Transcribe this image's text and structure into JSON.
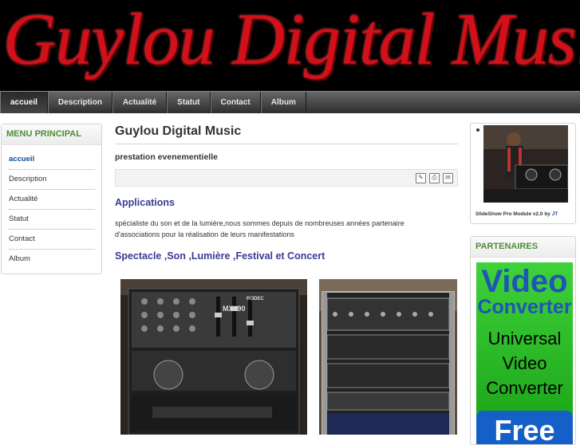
{
  "site": {
    "banner_title": "Guylou Digital Music"
  },
  "nav": {
    "items": [
      {
        "label": "accueil"
      },
      {
        "label": "Description"
      },
      {
        "label": "Actualité"
      },
      {
        "label": "Statut"
      },
      {
        "label": "Contact"
      },
      {
        "label": "Album"
      }
    ],
    "active": "accueil"
  },
  "sidebar": {
    "title": "MENU PRINCIPAL",
    "items": [
      {
        "label": "accueil"
      },
      {
        "label": "Description"
      },
      {
        "label": "Actualité"
      },
      {
        "label": "Statut"
      },
      {
        "label": "Contact"
      },
      {
        "label": "Album"
      }
    ]
  },
  "main": {
    "title": "Guylou Digital Music",
    "subtitle": "prestation evenementielle",
    "toolbar_icons": [
      "edit-icon",
      "print-icon",
      "email-icon"
    ],
    "section1_heading": "Applications",
    "section1_text_line1": "spécialiste du son et de la lumière,nous sommes depuis de nombreuses années partenaire",
    "section1_text_line2": "d'associations pour la réalisation de leurs manifestations",
    "section2_heading": "Spectacle ,Son ,Lumière ,Festival et Concert",
    "photo1_label": "MX190",
    "photo1_brand": "RODEC"
  },
  "right": {
    "slideshow_credit": "SlideShow Pro Module v2.0 by",
    "slideshow_credit_link": "JT",
    "partners_title": "PARTENAIRES",
    "ad": {
      "line1": "Video",
      "line2": "Converter",
      "line3": "Universal",
      "line4": "Video",
      "line5": "Converter",
      "button": "Free"
    }
  },
  "colors": {
    "banner_text": "#d3101a",
    "sidebar_title": "#4e8d3a",
    "heading_blue": "#3a3a96",
    "ad_green": "#2cc027",
    "ad_blue": "#1f55b8"
  }
}
